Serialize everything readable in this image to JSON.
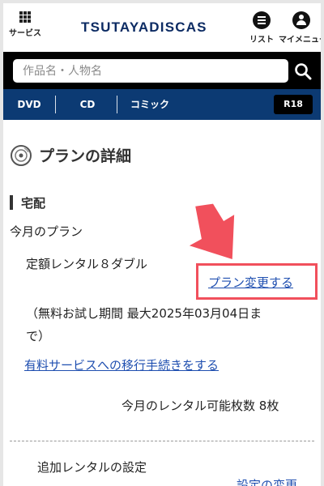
{
  "header": {
    "services_label": "サービス",
    "logo_text": "TSUTAYADISCAS",
    "list_label": "リスト",
    "mymenu_label": "マイメニュー"
  },
  "search": {
    "placeholder": "作品名・人物名"
  },
  "nav": {
    "items": [
      "DVD",
      "CD",
      "コミック"
    ],
    "r18_label": "R18"
  },
  "page": {
    "title": "プランの詳細",
    "section_title": "宅配",
    "current_plan_label": "今月のプラン",
    "plan_name": "定額レンタル８ダブル",
    "change_plan_link": "プラン変更する",
    "trial_line1": "（無料お試し期間 最大2025年03月04日ま",
    "trial_line2": "で）",
    "paid_service_link": "有料サービスへの移行手続きをする",
    "rental_count": "今月のレンタル可能枚数  8枚",
    "extra_rental_label": "追加レンタルの設定",
    "settings_change_link": "設定の変更"
  },
  "colors": {
    "brand_navy": "#0c3a73",
    "link_blue": "#1f4fb0",
    "highlight_red": "#f1505c"
  },
  "icons": [
    "services-grid-icon",
    "list-icon",
    "user-icon",
    "search-icon",
    "disc-icon",
    "arrow-annotation-icon"
  ]
}
